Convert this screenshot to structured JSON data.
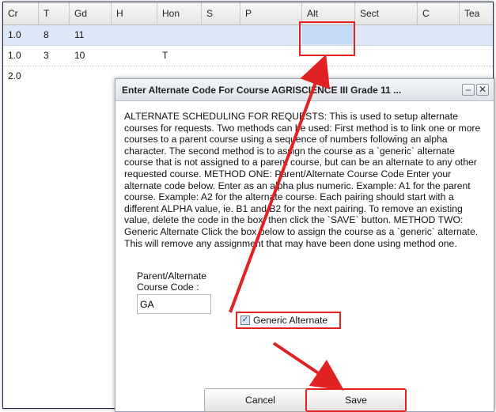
{
  "grid": {
    "columns": [
      "Cr",
      "T",
      "Gd",
      "H",
      "Hon",
      "S",
      "P",
      "Alt",
      "Sect",
      "C",
      "Tea"
    ],
    "rows": [
      {
        "Cr": "1.0",
        "T": "8",
        "Gd": "11",
        "H": "",
        "Hon": "",
        "Alt": ""
      },
      {
        "Cr": "1.0",
        "T": "3",
        "Gd": "10",
        "H": "",
        "Hon": "T",
        "Alt": ""
      },
      {
        "Cr": "2.0",
        "T": "",
        "Gd": "",
        "H": "",
        "Hon": "",
        "Alt": ""
      }
    ],
    "selected_row": 0
  },
  "dialog": {
    "title": "Enter Alternate Code For Course AGRISCIENCE III Grade 11 ...",
    "minimize_glyph": "–",
    "close_glyph": "✕",
    "description": "ALTERNATE SCHEDULING FOR REQUESTS: This is used to setup alternate courses for requests. Two methods can be used: First method is to link one or more courses to a parent course using a sequence of numbers following an alpha character. The second method is to assign the course as a `generic` alternate course that is not assigned to a parent course, but can be an alternate to any other requested course. METHOD ONE: Parent/Alternate Course Code Enter your alternate code below. Enter as an alpha plus numeric. Example: A1 for the parent course. Example: A2 for the alternate course. Each pairing should start with a different ALPHA value, ie. B1 and B2 for the next pairing. To remove an existing value, delete the code in the box, then click the `SAVE` button. METHOD TWO: Generic Alternate Click the box below to assign the course as a `generic` alternate. This will remove any assignment that may have been done using method one.",
    "code_label": "Parent/Alternate Course Code :",
    "code_value": "GA",
    "generic_label": "Generic Alternate",
    "generic_checked": true,
    "cancel_label": "Cancel",
    "save_label": "Save"
  },
  "colors": {
    "highlight": "#e02222",
    "selected_row": "#dde8f7",
    "alt_cell": "#c5daf6"
  }
}
